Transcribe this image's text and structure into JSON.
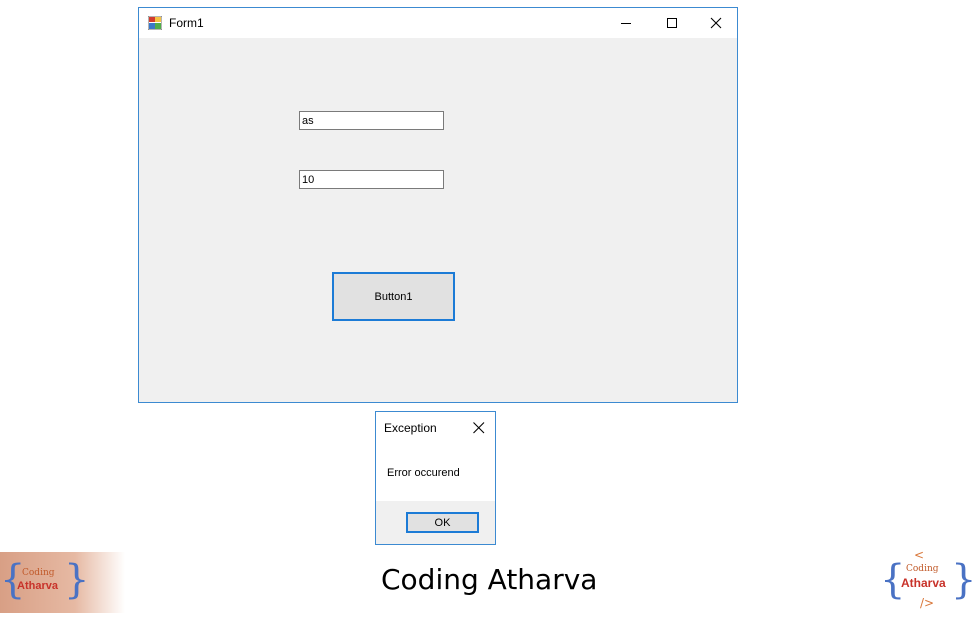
{
  "window": {
    "title": "Form1",
    "icon": "winforms-app-icon",
    "controls": [
      "minimize-icon",
      "maximize-icon",
      "close-icon"
    ]
  },
  "form": {
    "textbox1_value": "as",
    "textbox2_value": "10",
    "button1_label": "Button1"
  },
  "message_box": {
    "title": "Exception",
    "message": "Error occurend",
    "ok_label": "OK"
  },
  "branding": {
    "caption": "Coding Atharva",
    "logo_left": {
      "top": "Coding",
      "main": "Atharva"
    },
    "logo_right": {
      "top": "Coding",
      "main": "Atharva",
      "symbol_top": "<",
      "symbol_bottom": "/>"
    }
  },
  "colors": {
    "accent": "#1c7bd6",
    "window_border": "#3c8ad1",
    "form_bg": "#f0f0f0",
    "logo_red": "#c8322a",
    "logo_blue": "#4a72c4"
  }
}
